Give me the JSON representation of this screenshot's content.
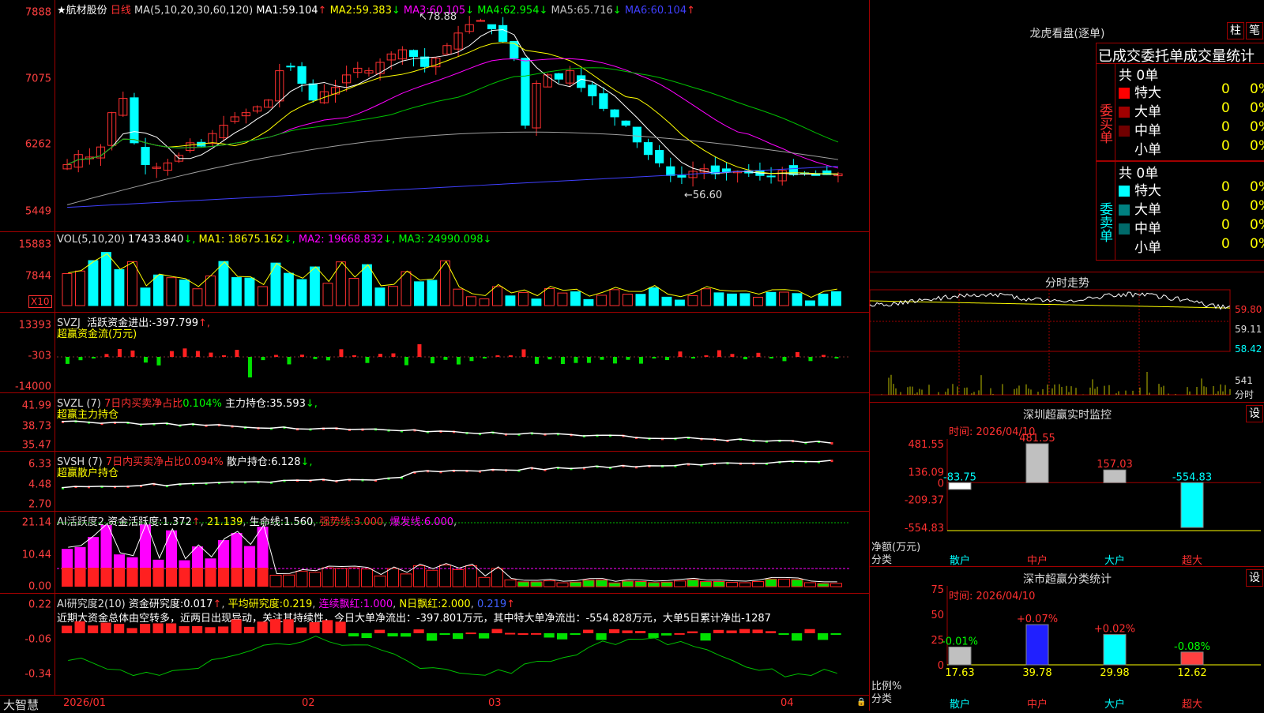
{
  "stock_name": "航材股份",
  "period": "日线",
  "ma_header": "MA(5,10,20,30,60,120)",
  "ma_values": [
    {
      "label": "MA1:",
      "value": "59.104",
      "arrow": "↑",
      "color": "#ffffff"
    },
    {
      "label": "MA2:",
      "value": "59.383",
      "arrow": "↓",
      "color": "#ffff00"
    },
    {
      "label": "MA3:",
      "value": "60.105",
      "arrow": "↓",
      "color": "#ff00ff"
    },
    {
      "label": "MA4:",
      "value": "62.954",
      "arrow": "↓",
      "color": "#00ff00"
    },
    {
      "label": "MA5:",
      "value": "65.716",
      "arrow": "↓",
      "color": "#c0c0c0"
    },
    {
      "label": "MA6:",
      "value": "60.104",
      "arrow": "↑",
      "color": "#4040ff"
    }
  ],
  "price_ticks": [
    "7888",
    "7075",
    "6262",
    "5449"
  ],
  "price_high_label": "78.88",
  "price_low_label": "56.60",
  "vol_header": {
    "name": "VOL(5,10,20)",
    "v": "17433.840",
    "ma1": "18675.162",
    "ma2": "19668.832",
    "ma3": "24990.098"
  },
  "vol_ticks": [
    "15883",
    "7844"
  ],
  "vol_unit": "X10",
  "svzj": {
    "name": "SVZJ",
    "title": "活跃资金进出:",
    "value": "-397.799",
    "sub": "超赢资金流(万元)",
    "ticks": [
      "13393",
      "-303",
      "-14000"
    ]
  },
  "svzl": {
    "name": "SVZL (7)",
    "title": "7日内买卖净占比",
    "ratio": "0.104%",
    "label2": "主力持仓:",
    "value": "35.593",
    "sub": "超赢主力持仓",
    "ticks": [
      "41.99",
      "38.73",
      "35.47"
    ]
  },
  "svsh": {
    "name": "SVSH (7)",
    "title": "7日内买卖净占比",
    "ratio": "0.094%",
    "label2": "散户持仓:",
    "value": "6.128",
    "sub": "超赢散户持仓",
    "ticks": [
      "6.33",
      "4.48",
      "2.70"
    ]
  },
  "ai1": {
    "name": "AI活跃度2",
    "l1": "资金活跃度:",
    "v1": "1.372",
    "v2": "21.139",
    "l3": "生命线:",
    "v3": "1.560",
    "l4": "强势线:",
    "v4": "3.000",
    "l5": "爆发线:",
    "v5": "6.000",
    "ticks": [
      "21.14",
      "10.44",
      "0.00"
    ]
  },
  "ai2": {
    "name": "AI研究度2(10)",
    "l1": "资金研究度:",
    "v1": "0.017",
    "l2": "平均研究度:",
    "v2": "0.219",
    "l3": "连续飘红:",
    "v3": "1.000",
    "l4": "N日飘红:",
    "v4": "2.000",
    "v5": "0.219",
    "ticks": [
      "0.22",
      "-0.06",
      "-0.34"
    ],
    "text": "近期大资金总体由空转多，近两日出现异动，关注其持续性，今日大单净流出：-397.801万元，其中特大单净流出：-554.828万元，大单5日累计净出-1287"
  },
  "date_axis": [
    "2026/01",
    "02",
    "03",
    "04"
  ],
  "brand": "大智慧",
  "dragon": {
    "title": "龙虎看盘(逐单)",
    "btn1": "柱",
    "btn2": "笔",
    "subtitle": "已成交委托单成交量统计",
    "buy_label": "委买单",
    "sell_label": "委卖单",
    "buy_total": "共 0单",
    "sell_total": "共 0单",
    "buy_rows": [
      {
        "name": "特大",
        "v": "0",
        "p": "0%",
        "color": "#ff0000"
      },
      {
        "name": "大单",
        "v": "0",
        "p": "0%",
        "color": "#a00000"
      },
      {
        "name": "中单",
        "v": "0",
        "p": "0%",
        "color": "#700000"
      },
      {
        "name": "小单",
        "v": "0",
        "p": "0%",
        "color": "#000000"
      }
    ],
    "sell_rows": [
      {
        "name": "特大",
        "v": "0",
        "p": "0%",
        "color": "#00ffff"
      },
      {
        "name": "大单",
        "v": "0",
        "p": "0%",
        "color": "#008080"
      },
      {
        "name": "中单",
        "v": "0",
        "p": "0%",
        "color": "#006a6a"
      },
      {
        "name": "小单",
        "v": "0",
        "p": "0%",
        "color": "#000000"
      }
    ]
  },
  "intraday": {
    "title": "分时走势",
    "ticks": [
      "59.80",
      "59.11",
      "58.42"
    ],
    "vol_tick": "541",
    "vol_label": "分时"
  },
  "monitor": {
    "title": "深圳超赢实时监控",
    "btn": "设",
    "time": "时间: 2026/04/10",
    "ylabel": "净额(万元)",
    "xlabel_title": "分类",
    "ticks": [
      "481.55",
      "136.09",
      "0",
      "-209.37",
      "-554.83"
    ]
  },
  "classify": {
    "title": "深市超赢分类统计",
    "btn": "设",
    "time": "时间: 2026/04/10",
    "ylabel": "比例%",
    "xlabel_title": "分类",
    "ticks": [
      "75",
      "50",
      "25",
      "0"
    ]
  },
  "chart_data": [
    {
      "type": "bar",
      "title": "深圳超赢实时监控",
      "ylabel": "净额(万元)",
      "categories": [
        "散户",
        "中户",
        "大户",
        "超大"
      ],
      "values": [
        -83.75,
        481.55,
        157.03,
        -554.83
      ],
      "ylim": [
        -554.83,
        481.55
      ]
    },
    {
      "type": "bar",
      "title": "深市超赢分类统计",
      "ylabel": "比例%",
      "categories": [
        "散户",
        "中户",
        "大户",
        "超大"
      ],
      "values": [
        17.63,
        39.78,
        29.98,
        12.62
      ],
      "changes": [
        "-0.01%",
        "+0.07%",
        "+0.02%",
        "-0.08%"
      ],
      "ylim": [
        0,
        75
      ]
    }
  ]
}
